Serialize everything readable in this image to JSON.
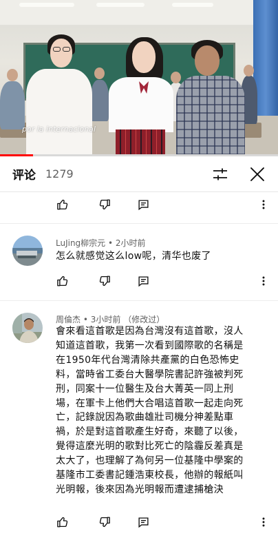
{
  "video": {
    "watermark": "por la internacional",
    "progress_fraction": 0.12
  },
  "header": {
    "title": "评论",
    "count": "1279",
    "filter_icon": "sliders-icon",
    "close_icon": "close-icon"
  },
  "comments": [
    {
      "author": "LuJing柳宗元",
      "time": "2小时前",
      "edited": "",
      "text_lines": [
        "怎么就感觉这么low呢，清华也废了"
      ]
    },
    {
      "author": "周倫杰",
      "time": "3小时前",
      "edited": "（修改过）",
      "text_lines": [
        "會來看這首歌是因為台灣沒有這首歌，沒人",
        "知道這首歌，我第一次看到國際歌的名稱是",
        "在1950年代台灣清除共產黨的白色恐怖史",
        "料，當時省工委台大醫學院書記許強被判死",
        "刑，同案十一位醫生及台大菁英一同上刑",
        "場，在軍卡上他們大合唱這首歌一起走向死",
        "亡，記錄說因為歌曲雄壯司機分神差點車",
        "禍，於是對這首歌產生好奇，來聽了以後，",
        "覺得這麼光明的歌對比死亡的陰霾反差真是",
        "太大了，也理解了為何另一位基隆中學案的",
        "基隆市工委書記鍾浩東校長，他辦的報紙叫",
        "光明報，後來因為光明報而遭逮捕槍決"
      ]
    }
  ],
  "action_icons": {
    "like": "thumb-up-icon",
    "dislike": "thumb-down-icon",
    "reply": "reply-icon",
    "more": "more-vertical-icon"
  },
  "colors": {
    "text": "#0f0f0f",
    "secondary": "#606060",
    "progress": "#ff0000"
  }
}
